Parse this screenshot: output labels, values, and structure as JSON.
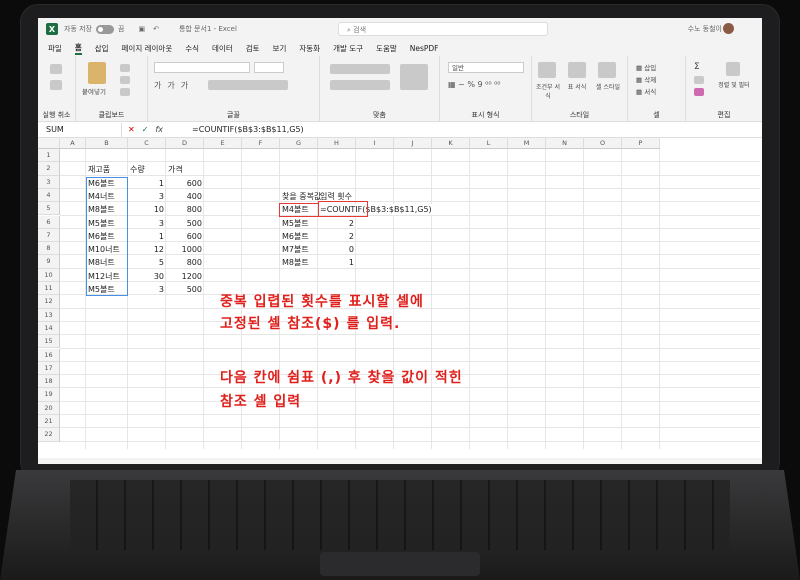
{
  "titlebar": {
    "autosave_label": "자동 저장",
    "autosave_state": "끔",
    "doc_title": "통합 문서1 - Excel",
    "search_placeholder": "검색",
    "user_name": "수노 동철이"
  },
  "tabs": [
    "파일",
    "홈",
    "삽입",
    "페이지 레이아웃",
    "수식",
    "데이터",
    "검토",
    "보기",
    "자동화",
    "개발 도구",
    "도움말",
    "NesPDF"
  ],
  "active_tab": "홈",
  "ribbon": {
    "groups": [
      "실행 취소",
      "클립보드",
      "글꼴",
      "맞춤",
      "표시 형식",
      "스타일",
      "셀",
      "편집"
    ],
    "paste_label": "붙여넣기",
    "number_format": "일반",
    "cond_format": "조건부 서식",
    "table_format": "표 서식",
    "cell_style": "셀 스타일",
    "insert": "삽입",
    "delete": "삭제",
    "format": "서식",
    "sort_filter": "정렬 및 필터"
  },
  "formula_bar": {
    "name_box": "SUM",
    "fx": "fx",
    "formula": "=COUNTIF($B$3:$B$11,G5)"
  },
  "columns": [
    "A",
    "B",
    "C",
    "D",
    "E",
    "F",
    "G",
    "H",
    "I",
    "J",
    "K",
    "L",
    "M",
    "N",
    "O",
    "P"
  ],
  "rows": [
    "1",
    "2",
    "3",
    "4",
    "5",
    "6",
    "7",
    "8",
    "9",
    "10",
    "11",
    "12",
    "13",
    "14",
    "15",
    "16",
    "17",
    "18",
    "19",
    "20",
    "21",
    "22"
  ],
  "headers": {
    "item": "재고품",
    "qty": "수량",
    "price": "가격"
  },
  "inventory": [
    {
      "item": "M6볼트",
      "qty": "1",
      "price": "600"
    },
    {
      "item": "M4너트",
      "qty": "3",
      "price": "400"
    },
    {
      "item": "M8볼트",
      "qty": "10",
      "price": "800"
    },
    {
      "item": "M5볼트",
      "qty": "3",
      "price": "500"
    },
    {
      "item": "M6볼트",
      "qty": "1",
      "price": "600"
    },
    {
      "item": "M10너트",
      "qty": "12",
      "price": "1000"
    },
    {
      "item": "M8너트",
      "qty": "5",
      "price": "800"
    },
    {
      "item": "M12너트",
      "qty": "30",
      "price": "1200"
    },
    {
      "item": "M5볼트",
      "qty": "3",
      "price": "500"
    }
  ],
  "lookup": {
    "header_g": "찾을 중복값",
    "header_h": "입력 횟수",
    "editing_formula": "=COUNTIF($B$3:$B$11,G5)",
    "rows": [
      {
        "g": "M4볼트",
        "h": ""
      },
      {
        "g": "M5볼트",
        "h": "2"
      },
      {
        "g": "M6볼트",
        "h": "2"
      },
      {
        "g": "M7볼트",
        "h": "0"
      },
      {
        "g": "M8볼트",
        "h": "1"
      }
    ]
  },
  "annotation": {
    "line1": "중복 입렵된 횟수를 표시할 셀에",
    "line2": "고정된 셀 참조($) 를 입력.",
    "line3": "다음 칸에 쉼표 (,) 후 찾을 값이 적힌",
    "line4": "참조 셀 입력"
  },
  "colors": {
    "excel_green": "#1d6f42",
    "annotation_red": "#e0201c",
    "selection_blue": "#4a90e2"
  }
}
